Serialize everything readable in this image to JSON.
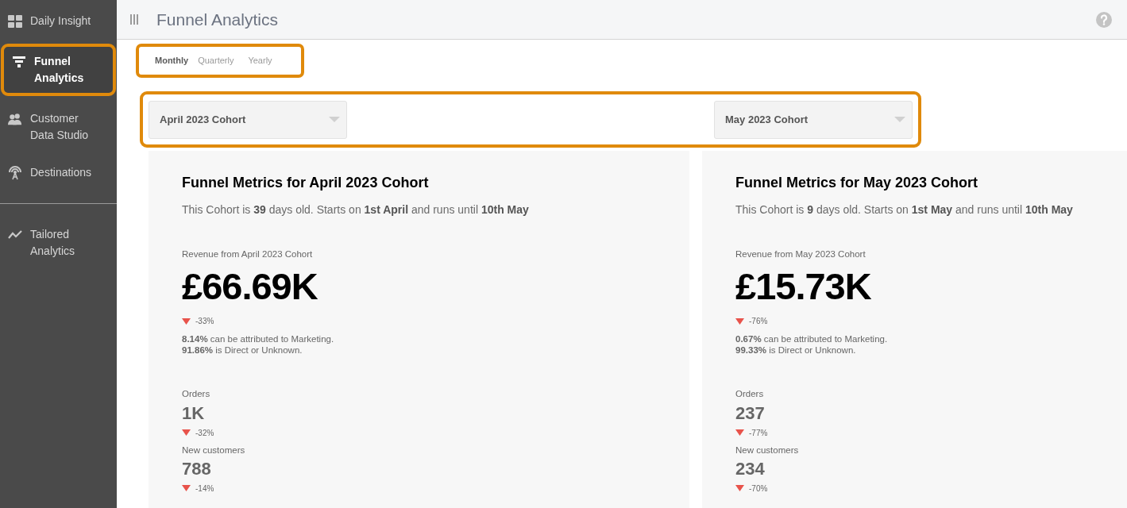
{
  "sidebar": {
    "sections": [
      {
        "items": [
          {
            "label": "Daily Insight",
            "selected": false
          },
          {
            "label": "Funnel Analytics",
            "selected": true
          },
          {
            "label": "Customer Data Studio",
            "selected": false
          },
          {
            "label": "Destinations",
            "selected": false
          }
        ]
      },
      {
        "items": [
          {
            "label": "Tailored Analytics",
            "selected": false
          }
        ]
      }
    ]
  },
  "header": {
    "title": "Funnel Analytics"
  },
  "periods": [
    {
      "label": "Monthly",
      "selected": true
    },
    {
      "label": "Quarterly",
      "selected": false
    },
    {
      "label": "Yearly",
      "selected": false
    }
  ],
  "dropdowns": [
    {
      "value": "April 2023 Cohort"
    },
    {
      "value": "May 2023 Cohort"
    }
  ],
  "cohorts": [
    {
      "title": "Funnel Metrics for April 2023 Cohort",
      "summary": "This Cohort is **39** days old. Starts on **1st April** and runs until **10th May**",
      "revenue_label": "Revenue from April 2023 Cohort",
      "revenue": "£66.69K",
      "revenue_change": "-33%",
      "attribution": [
        "**8.14%** can be attributed to Marketing.",
        "**91.86%** is Direct or Unknown."
      ],
      "metrics": [
        {
          "label": "Orders",
          "value": "1K",
          "change": "-32%"
        },
        {
          "label": "New customers",
          "value": "788",
          "change": "-14%"
        }
      ]
    },
    {
      "title": "Funnel Metrics for May 2023 Cohort",
      "summary": "This Cohort is **9** days old. Starts on **1st May** and runs until **10th May**",
      "revenue_label": "Revenue from May 2023 Cohort",
      "revenue": "£15.73K",
      "revenue_change": "-76%",
      "attribution": [
        "**0.67%** can be attributed to Marketing.",
        "**99.33%** is Direct or Unknown."
      ],
      "metrics": [
        {
          "label": "Orders",
          "value": "237",
          "change": "-77%"
        },
        {
          "label": "New customers",
          "value": "234",
          "change": "-70%"
        }
      ]
    }
  ]
}
